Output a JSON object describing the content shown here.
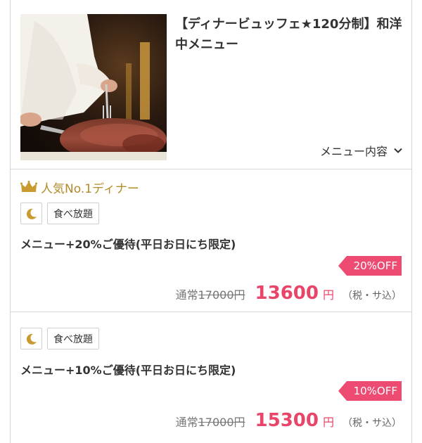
{
  "header": {
    "title": "【ディナービュッフェ★120分制】和洋中メニュー",
    "menu_link_label": "メニュー内容",
    "photo_icon": "roast-beef-carving-photo"
  },
  "plans": [
    {
      "badge": "人気No.1ディナー",
      "tag_icon": "moon-icon",
      "tag_label": "食べ放題",
      "name": "メニュー+20%ご優待(平日お日にち限定)",
      "discount": "20%OFF",
      "regular_prefix": "通常",
      "regular_price": "17000円",
      "price": "13600",
      "yen": "円",
      "tax": "（税・サ込）"
    },
    {
      "badge": "",
      "tag_icon": "moon-icon",
      "tag_label": "食べ放題",
      "name": "メニュー+10%ご優待(平日お日にち限定)",
      "discount": "10%OFF",
      "regular_prefix": "通常",
      "regular_price": "17000円",
      "price": "15300",
      "yen": "円",
      "tax": "（税・サ込）"
    }
  ],
  "colors": {
    "accent_pink": "#ee4b73",
    "price_pink": "#e94569",
    "gold": "#b38a2a",
    "border": "#d6d6d6"
  }
}
